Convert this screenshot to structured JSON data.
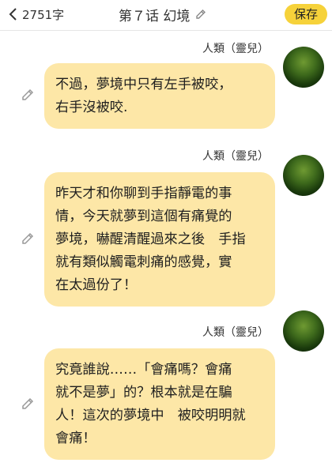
{
  "header": {
    "back_label": "2751字",
    "title": "第７话 幻境",
    "save_label": "保存"
  },
  "messages": [
    {
      "speaker": "人類（靈兒）",
      "lines": [
        "不過，夢境中只有左手被咬，",
        "右手沒被咬."
      ]
    },
    {
      "speaker": "人類（靈兒）",
      "lines": [
        "昨天才和你聊到手指靜電的事",
        "情，今天就夢到這個有痛覺的",
        "夢境，嚇醒清醒過來之後　手指",
        "就有類似觸電刺痛的感覺，實",
        "在太過份了！"
      ]
    },
    {
      "speaker": "人類（靈兒）",
      "lines": [
        "究竟誰說……「會痛嗎？會痛",
        "就不是夢」的？根本就是在騙",
        "人！這次的夢境中　被咬明明就",
        "會痛！"
      ]
    }
  ],
  "colors": {
    "bubble": "#fde7a7",
    "save_button": "#f6d23a",
    "avatar": "#2f5a16"
  }
}
